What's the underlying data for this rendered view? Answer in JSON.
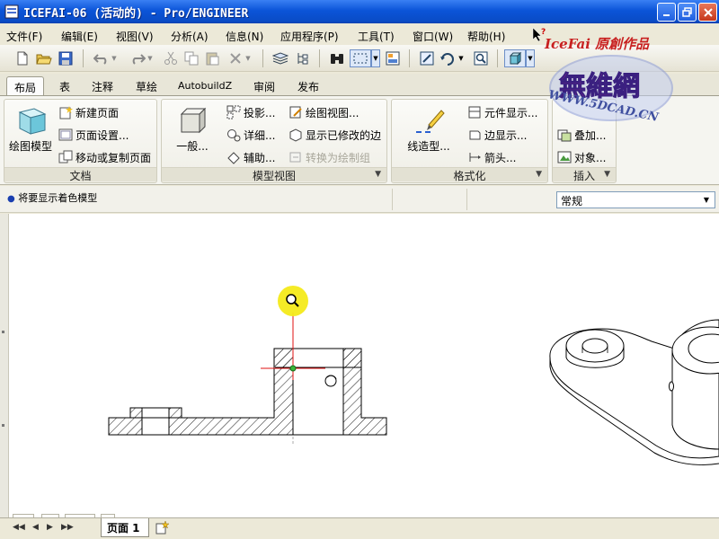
{
  "window": {
    "title": "ICEFAI-06 (活动的) - Pro/ENGINEER"
  },
  "menu": [
    "文件(F)",
    "编辑(E)",
    "视图(V)",
    "分析(A)",
    "信息(N)",
    "应用程序(P)",
    "工具(T)",
    "窗口(W)",
    "帮助(H)"
  ],
  "tabs": [
    "布局",
    "表",
    "注释",
    "草绘",
    "AutobuildZ",
    "审阅",
    "发布"
  ],
  "ribbon": {
    "doc": {
      "caption": "文档",
      "draw_model": "绘图模型",
      "new_page": "新建页面",
      "page_setup": "页面设置...",
      "move_copy_page": "移动或复制页面"
    },
    "model_views": {
      "caption": "模型视图",
      "general": "一般...",
      "projection": "投影...",
      "detail": "详细...",
      "auxiliary": "辅助...",
      "drawing_view": "绘图视图...",
      "show_modified_edges": "显示已修改的边",
      "convert_to_draw_group": "转换为绘制组"
    },
    "format": {
      "caption": "格式化",
      "line_style": "线造型...",
      "component_display": "元件显示...",
      "edge_display": "边显示...",
      "arrow": "箭头..."
    },
    "insert": {
      "caption": "插入",
      "overlay": "叠加...",
      "object": "对象..."
    }
  },
  "status": {
    "message": "将要显示着色模型",
    "style_value": "常规"
  },
  "bottom": {
    "page_label": "页面 1"
  },
  "watermark": {
    "line1": "IceFai 原創作品",
    "line2": "無維網",
    "line3": "WWW.5DCAD.CN"
  }
}
